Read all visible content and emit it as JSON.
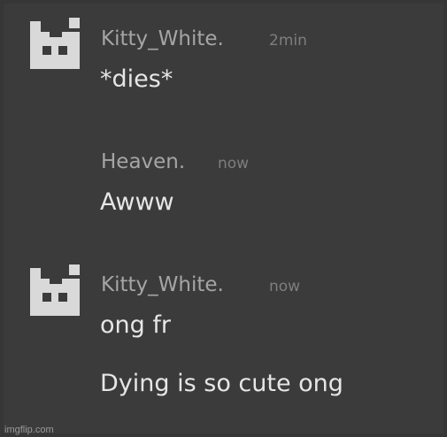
{
  "messages": [
    {
      "username": "Kitty_White.",
      "time": "2min",
      "avatar_icon": "kitty-pixel-icon",
      "lines": [
        "*dies*"
      ]
    },
    {
      "username": "Heaven.",
      "time": "now",
      "lines": [
        "Awww"
      ]
    },
    {
      "username": "Kitty_White.",
      "time": "now",
      "avatar_icon": "kitty-pixel-icon",
      "lines": [
        "ong fr",
        "Dying is so cute ong"
      ]
    }
  ],
  "watermark": "imgflip.com",
  "colors": {
    "background": "#3b3b3b",
    "username": "#a5a5a5",
    "timestamp": "#7e7e7e",
    "message_text": "#e6e6e6",
    "avatar": "#d9d9d9"
  }
}
